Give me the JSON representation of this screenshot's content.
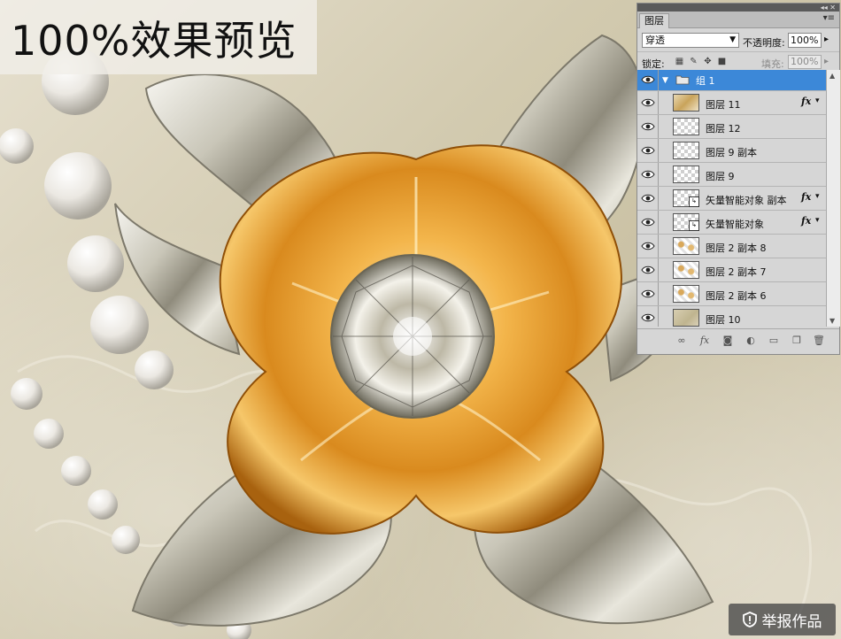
{
  "canvas": {
    "title": "100%效果预览"
  },
  "report_button": {
    "label": "举报作品",
    "icon": "shield-icon"
  },
  "layers_panel": {
    "tab_label": "图层",
    "blend_mode": "穿透",
    "opacity_label": "不透明度:",
    "opacity_value": "100%",
    "lock_label": "锁定:",
    "lock_icons": [
      "lock-transparent-icon",
      "lock-paint-icon",
      "lock-move-icon",
      "lock-all-icon"
    ],
    "fill_label": "填充:",
    "fill_value": "100%",
    "group": {
      "name": "组 1",
      "icon": "folder-icon",
      "selected_color": "#3c88d8"
    },
    "layers": [
      {
        "name": "图层 11",
        "thumb": "art",
        "fx": "fx"
      },
      {
        "name": "图层 12",
        "thumb": "transparent",
        "fx": ""
      },
      {
        "name": "图层 9 副本",
        "thumb": "transparent",
        "fx": ""
      },
      {
        "name": "图层 9",
        "thumb": "transparent",
        "fx": ""
      },
      {
        "name": "矢量智能对象 副本",
        "thumb": "smart",
        "fx": "fx"
      },
      {
        "name": "矢量智能对象",
        "thumb": "smart",
        "fx": "fx"
      },
      {
        "name": "图层 2 副本 8",
        "thumb": "art2",
        "fx": ""
      },
      {
        "name": "图层 2 副本 7",
        "thumb": "art2",
        "fx": ""
      },
      {
        "name": "图层 2 副本 6",
        "thumb": "art2",
        "fx": ""
      },
      {
        "name": "图层 10",
        "thumb": "bg",
        "fx": ""
      }
    ],
    "footer_icons": [
      "link-layers-icon",
      "layer-style-icon",
      "layer-mask-icon",
      "adjustment-layer-icon",
      "new-group-icon",
      "new-layer-icon",
      "delete-layer-icon"
    ]
  }
}
